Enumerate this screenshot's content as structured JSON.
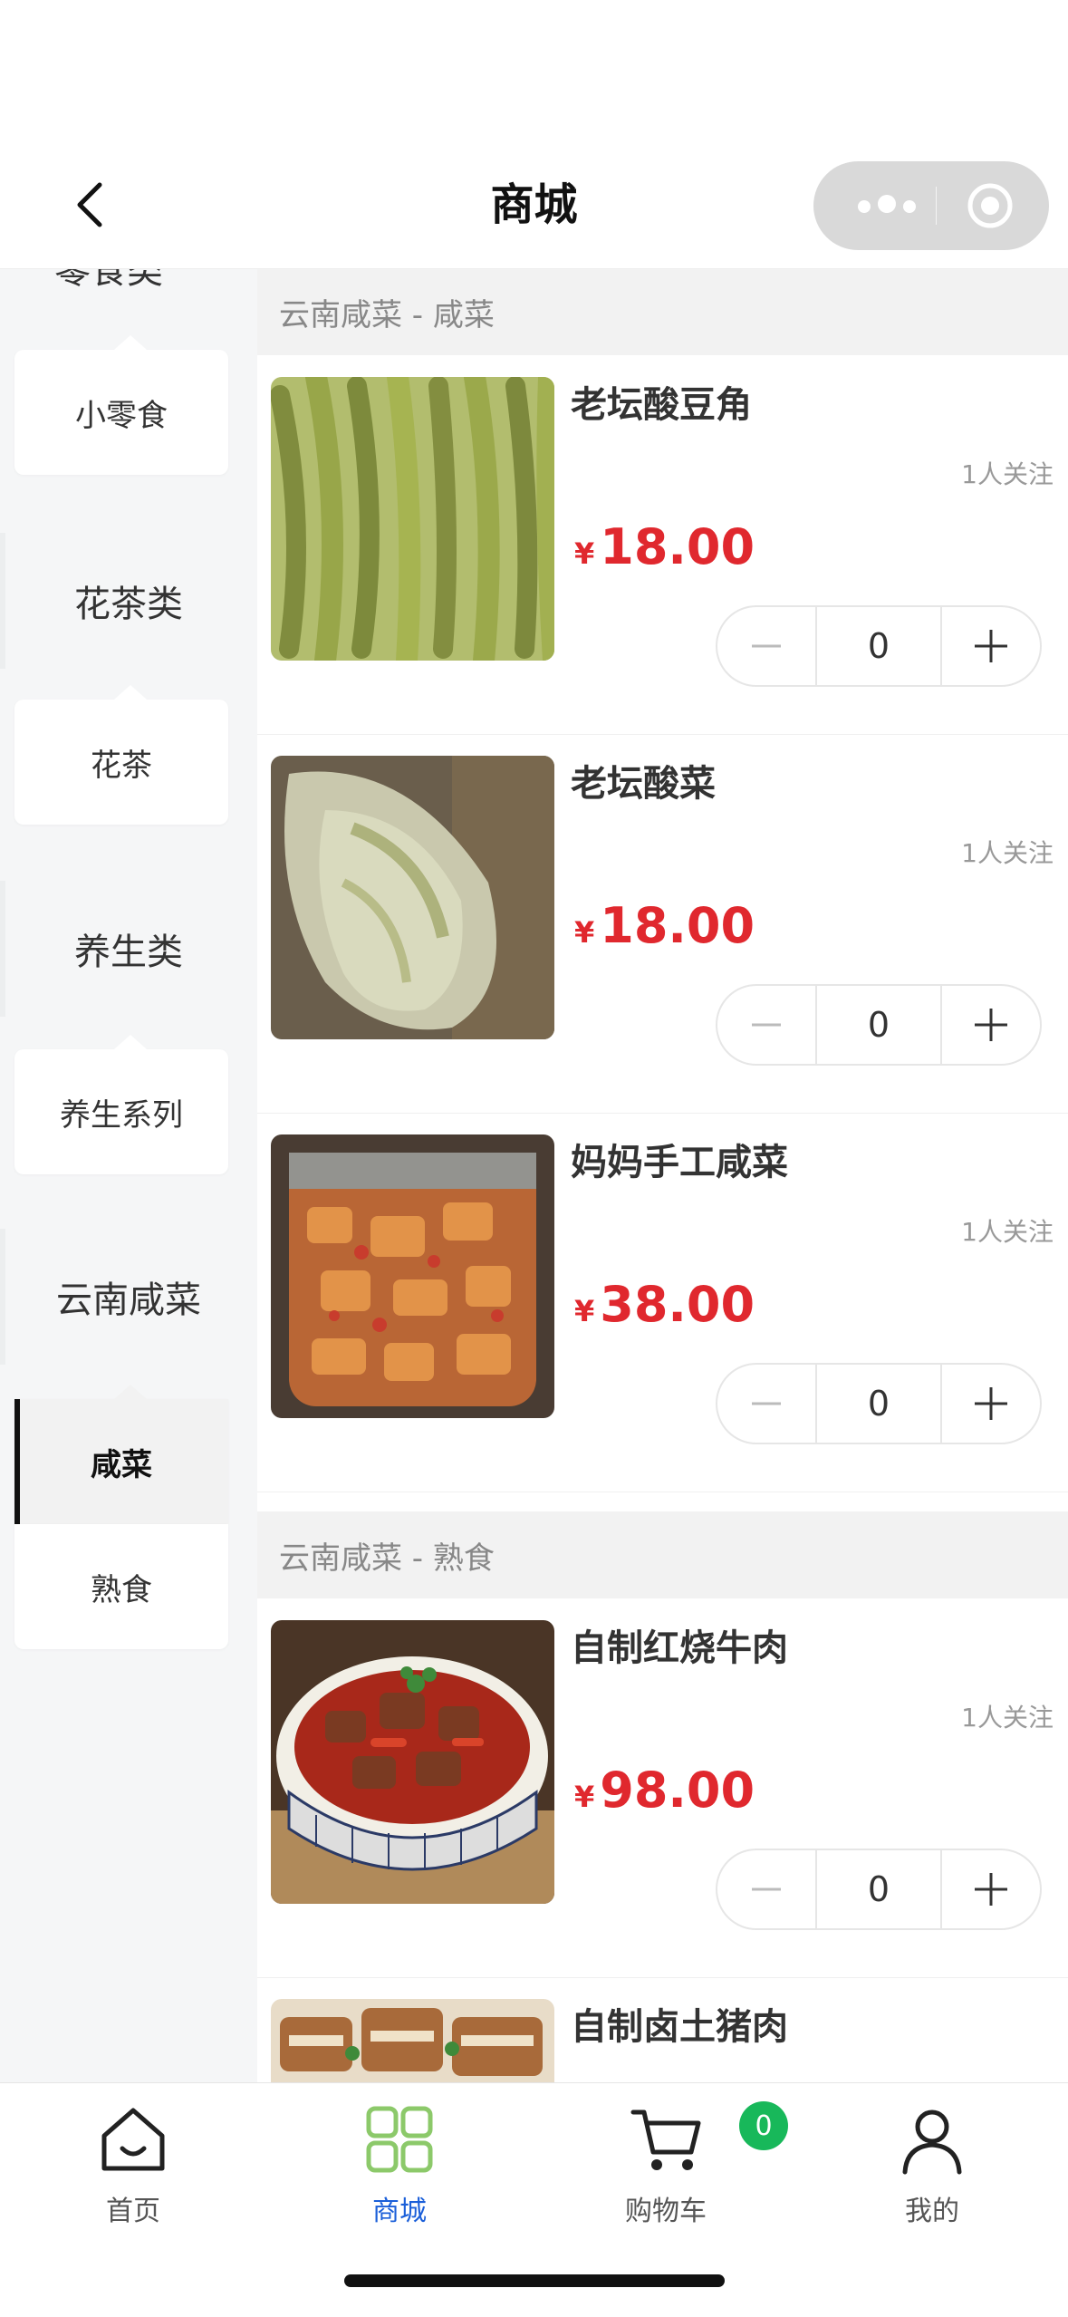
{
  "header": {
    "title": "商城"
  },
  "sidebar": {
    "cut_top_text": "零食类",
    "categories": [
      {
        "label": "花茶类"
      },
      {
        "label": "养生类"
      },
      {
        "label": "云南咸菜"
      }
    ],
    "subs": {
      "snack": "小零食",
      "tea": "花茶",
      "health": "养生系列",
      "pickle": "咸菜",
      "cooked": "熟食"
    }
  },
  "main": {
    "sections": [
      {
        "title": "云南咸菜 - 咸菜",
        "products": [
          {
            "name": "老坛酸豆角",
            "follow": "1人关注",
            "currency": "¥",
            "price": "18.00",
            "qty": "0"
          },
          {
            "name": "老坛酸菜",
            "follow": "1人关注",
            "currency": "¥",
            "price": "18.00",
            "qty": "0"
          },
          {
            "name": "妈妈手工咸菜",
            "follow": "1人关注",
            "currency": "¥",
            "price": "38.00",
            "qty": "0"
          }
        ]
      },
      {
        "title": "云南咸菜 - 熟食",
        "products": [
          {
            "name": "自制红烧牛肉",
            "follow": "1人关注",
            "currency": "¥",
            "price": "98.00",
            "qty": "0"
          },
          {
            "name": "自制卤土猪肉"
          }
        ]
      }
    ]
  },
  "tabbar": {
    "items": [
      {
        "label": "首页"
      },
      {
        "label": "商城"
      },
      {
        "label": "购物车"
      },
      {
        "label": "我的"
      }
    ],
    "cart_badge": "0",
    "active_color": "#1b5fd9",
    "badge_color": "#18b85a",
    "shop_icon_color": "#8cc96a"
  },
  "colors": {
    "price": "#e0282e"
  }
}
